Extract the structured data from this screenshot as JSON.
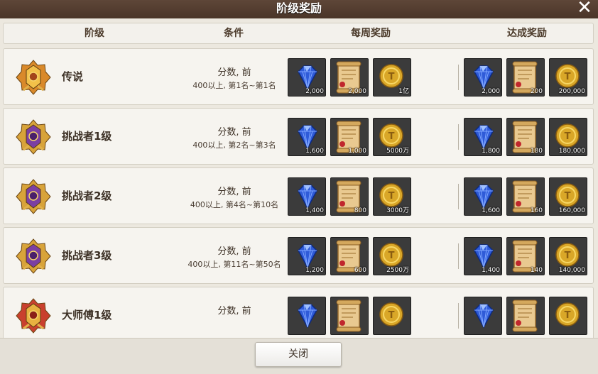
{
  "title": "阶级奖励",
  "header": {
    "rank": "阶级",
    "condition": "条件",
    "weekly": "每周奖励",
    "achieve": "达成奖励"
  },
  "rows": [
    {
      "rank": "传说",
      "badge": "legend-badge-icon",
      "cond_line1": "分数, 前",
      "cond_line2": "400以上, 第1名~第1名",
      "weekly": [
        "2,000",
        "2,000",
        "1亿"
      ],
      "achieve": [
        "2,000",
        "200",
        "200,000"
      ]
    },
    {
      "rank": "挑战者1级",
      "badge": "challenger-badge-icon",
      "cond_line1": "分数, 前",
      "cond_line2": "400以上, 第2名~第3名",
      "weekly": [
        "1,600",
        "1,000",
        "5000万"
      ],
      "achieve": [
        "1,800",
        "180",
        "180,000"
      ]
    },
    {
      "rank": "挑战者2级",
      "badge": "challenger-badge-icon",
      "cond_line1": "分数, 前",
      "cond_line2": "400以上, 第4名~第10名",
      "weekly": [
        "1,400",
        "800",
        "3000万"
      ],
      "achieve": [
        "1,600",
        "160",
        "160,000"
      ]
    },
    {
      "rank": "挑战者3级",
      "badge": "challenger-badge-icon",
      "cond_line1": "分数, 前",
      "cond_line2": "400以上, 第11名~第50名",
      "weekly": [
        "1,200",
        "600",
        "2500万"
      ],
      "achieve": [
        "1,400",
        "140",
        "140,000"
      ]
    },
    {
      "rank": "大师傅1级",
      "badge": "master-badge-icon",
      "cond_line1": "分数, 前",
      "cond_line2": "",
      "weekly": [
        "",
        "",
        ""
      ],
      "achieve": [
        "",
        "",
        ""
      ]
    }
  ],
  "item_icons": [
    "blue-gem-icon",
    "scroll-icon",
    "gold-coin-icon"
  ],
  "close_button": "关闭",
  "close_icon": "close-icon",
  "colors": {
    "titlebar": "#4f392c",
    "row_bg": "#f6f4ef",
    "item_bg": "#3b3b3b",
    "text": "#3d3126"
  }
}
